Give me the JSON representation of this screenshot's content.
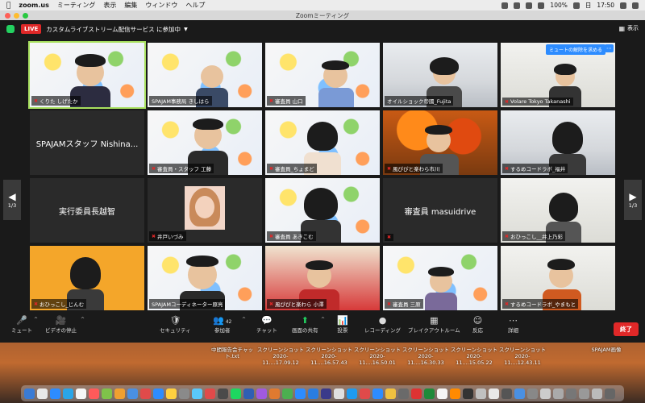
{
  "menubar": {
    "app_name": "zoom.us",
    "items": [
      "ミーティング",
      "表示",
      "編集",
      "ウィンドウ",
      "ヘルプ"
    ],
    "battery": "100%",
    "clock_day": "日",
    "clock_time": "17:50"
  },
  "window": {
    "title": "Zoomミーティング"
  },
  "topbar": {
    "live_label": "LIVE",
    "stream_text": "カスタムライブストリーム配信サービス に参加中",
    "view_label": "表示"
  },
  "gallery": {
    "page_left": "1/3",
    "page_right": "1/3",
    "unmute_request": "ミュートの解除を求める",
    "tiles": [
      {
        "name": "くりた しげたか",
        "center": ""
      },
      {
        "name": "SPAJAM事務局 きしはら",
        "center": ""
      },
      {
        "name": "審査員 山口",
        "center": ""
      },
      {
        "name": "オイルショック帝國_Fujita",
        "center": ""
      },
      {
        "name": "Volare Tokyo Takanashi",
        "center": ""
      },
      {
        "name": "",
        "center": "SPAJAMスタッフ Nishina..."
      },
      {
        "name": "審査員・スタッフ 工藤",
        "center": ""
      },
      {
        "name": "審査員_ちょまど",
        "center": ""
      },
      {
        "name": "風ぴぴと楽わら市川",
        "center": ""
      },
      {
        "name": "するめコードラボ_福井",
        "center": ""
      },
      {
        "name": "",
        "center": "実行委員長越智"
      },
      {
        "name": "井戸いづみ",
        "center": ""
      },
      {
        "name": "審査員 あきこむ",
        "center": ""
      },
      {
        "name": "",
        "center": "審査員 masuidrive"
      },
      {
        "name": "おひっこし__井上乃彩",
        "center": ""
      },
      {
        "name": "おひっこし_じんむ",
        "center": ""
      },
      {
        "name": "SPAJAMコーディネーター原亮",
        "center": ""
      },
      {
        "name": "風ぴぴと楽わら 小澤",
        "center": ""
      },
      {
        "name": "審査員 三原",
        "center": ""
      },
      {
        "name": "するめコードラボ_やまもと",
        "center": ""
      }
    ]
  },
  "controls": {
    "mute": "ミュート",
    "video": "ビデオの停止",
    "security": "セキュリティ",
    "participants": "参加者",
    "participants_count": "42",
    "chat": "チャット",
    "share": "画面の共有",
    "poll": "投票",
    "record": "レコーディング",
    "breakout": "ブレイクアウトルーム",
    "reactions": "反応",
    "details": "詳細",
    "end": "終了"
  },
  "desktop_files": [
    {
      "line1": "中間報告会チャッ",
      "line2": "ト.txt"
    },
    {
      "line1": "スクリーンショット",
      "line2": "2020-11....17.09.12"
    },
    {
      "line1": "スクリーンショット",
      "line2": "2020-11....16.57.43"
    },
    {
      "line1": "スクリーンショット",
      "line2": "2020-11....16.50.01"
    },
    {
      "line1": "スクリーンショット",
      "line2": "2020-11....16.30.33"
    },
    {
      "line1": "スクリーンショット",
      "line2": "2020-11....15.05.22"
    },
    {
      "line1": "スクリーンショット",
      "line2": "2020-11....12.43.11"
    },
    {
      "line1": "SPAJAM画像",
      "line2": ""
    }
  ],
  "dock_colors": [
    "#3a7bd5",
    "#e8e8e8",
    "#2d8cff",
    "#2aa5e8",
    "#f5f5f5",
    "#ff5a5a",
    "#7fc24a",
    "#f0a030",
    "#4a90e2",
    "#e04a4a",
    "#2d8cff",
    "#ffd040",
    "#8a8a8a",
    "#5ac8fa",
    "#e04a4a",
    "#4a4a4a",
    "#1ed760",
    "#2f5fb3",
    "#a05ae0",
    "#e07a30",
    "#4caf50",
    "#2d8cff",
    "#2a7de1",
    "#3a3a8a",
    "#e0e0e0",
    "#1d9bf0",
    "#e04a4a",
    "#2d8cff",
    "#f0c040",
    "#6a6a6a",
    "#d33",
    "#1f8a3a",
    "#f5f5f5",
    "#ff8a00",
    "#333",
    "#c0c0c0",
    "#e8e8e8",
    "#555",
    "#4a90e2",
    "#888",
    "#ccc",
    "#aaa",
    "#777",
    "#999",
    "#bbb",
    "#666"
  ]
}
